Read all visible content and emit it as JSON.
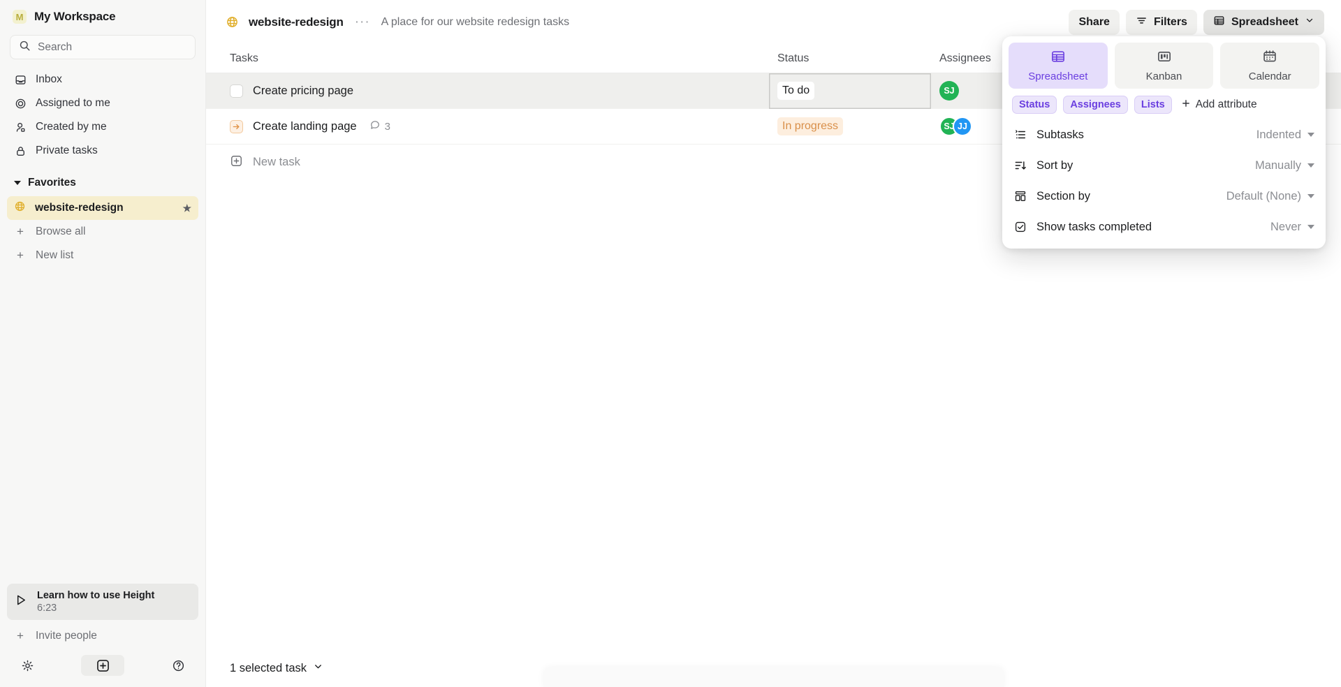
{
  "sidebar": {
    "workspace": {
      "initial": "M",
      "name": "My Workspace"
    },
    "search": {
      "placeholder": "Search"
    },
    "nav_items": [
      {
        "label": "Inbox",
        "icon": "inbox-icon"
      },
      {
        "label": "Assigned to me",
        "icon": "target-icon"
      },
      {
        "label": "Created by me",
        "icon": "user-icon"
      },
      {
        "label": "Private tasks",
        "icon": "lock-icon"
      }
    ],
    "favorites": {
      "section_label": "Favorites",
      "items": [
        {
          "label": "website-redesign",
          "icon": "globe-icon",
          "starred": true
        }
      ]
    },
    "actions": [
      {
        "label": "Browse all",
        "icon": "plus-icon"
      },
      {
        "label": "New list",
        "icon": "plus-icon"
      }
    ],
    "learn_card": {
      "title": "Learn how to use Height",
      "duration": "6:23",
      "icon": "play-icon"
    },
    "invite": {
      "label": "Invite people",
      "icon": "plus-icon"
    },
    "footer_icons": [
      "gear-icon",
      "plus-box-icon",
      "help-icon"
    ]
  },
  "topbar": {
    "project_icon": "globe-icon",
    "project_name": "website-redesign",
    "more_label": "···",
    "description": "A place for our website redesign tasks",
    "share_label": "Share",
    "filters_label": "Filters",
    "view_label": "Spreadsheet"
  },
  "table": {
    "columns": [
      "Tasks",
      "Status",
      "Assignees"
    ],
    "rows": [
      {
        "title": "Create pricing page",
        "icon": "checkbox-icon",
        "comments": null,
        "status": "To do",
        "status_kind": "todo",
        "selected": true,
        "assignees": [
          {
            "initials": "SJ",
            "color": "#22b355"
          }
        ]
      },
      {
        "title": "Create landing page",
        "icon": "in-progress-icon",
        "comments": "3",
        "status": "In progress",
        "status_kind": "prog",
        "selected": false,
        "assignees": [
          {
            "initials": "SJ",
            "color": "#22b355"
          },
          {
            "initials": "JJ",
            "color": "#2196f3"
          }
        ]
      }
    ],
    "new_task_label": "New task"
  },
  "bottombar": {
    "selection_label": "1 selected task"
  },
  "panel": {
    "views": [
      {
        "label": "Spreadsheet",
        "icon": "spreadsheet-icon",
        "selected": true
      },
      {
        "label": "Kanban",
        "icon": "kanban-icon",
        "selected": false
      },
      {
        "label": "Calendar",
        "icon": "calendar-icon",
        "selected": false
      }
    ],
    "attributes": [
      "Status",
      "Assignees",
      "Lists"
    ],
    "add_attribute_label": "Add attribute",
    "options": [
      {
        "label": "Subtasks",
        "value": "Indented",
        "icon": "subtasks-icon"
      },
      {
        "label": "Sort by",
        "value": "Manually",
        "icon": "sort-icon"
      },
      {
        "label": "Section by",
        "value": "Default (None)",
        "icon": "section-icon"
      },
      {
        "label": "Show tasks completed",
        "value": "Never",
        "icon": "checkmark-box-icon"
      }
    ]
  },
  "colors": {
    "accent_purple": "#6b3fe0",
    "favorite_highlight": "#f6eece",
    "in_progress": "#d98f49",
    "avatar_green": "#22b355",
    "avatar_blue": "#2196f3"
  }
}
